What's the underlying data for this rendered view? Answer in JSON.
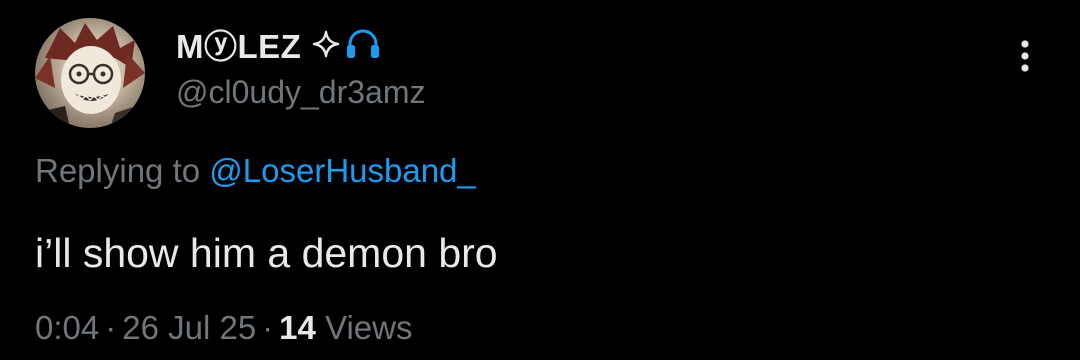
{
  "author": {
    "display_name": "MⓨLEZ",
    "handle": "@cl0udy_dr3amz",
    "name_icons": [
      "sparkle-icon",
      "headphones-icon"
    ],
    "headphones_color": "#1d9bf0"
  },
  "reply": {
    "prefix": "Replying to ",
    "mention": "@LoserHusband_"
  },
  "tweet": {
    "text": "i’ll show him a demon bro"
  },
  "meta": {
    "time": "0:04",
    "separator": "·",
    "date": "26 Jul 25",
    "views_count": "14",
    "views_label": "Views"
  },
  "colors": {
    "background": "#000000",
    "primary_text": "#e7e9ea",
    "secondary_text": "#71767b",
    "link": "#1d9bf0"
  }
}
